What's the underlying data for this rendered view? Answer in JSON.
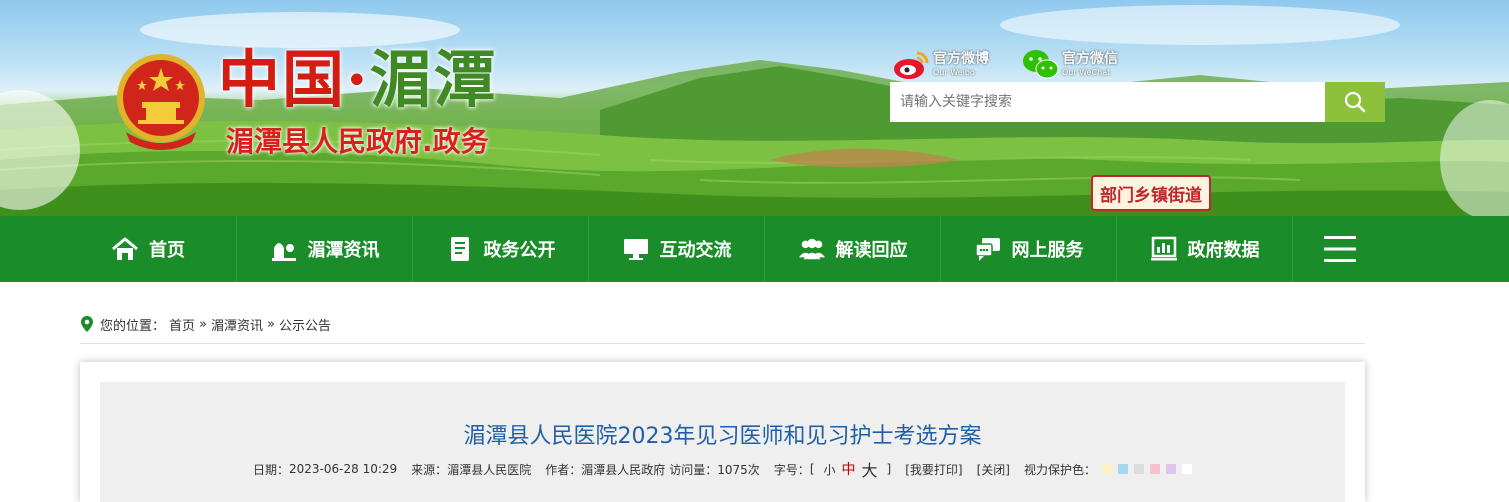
{
  "header": {
    "title_part1": "中国",
    "title_dot": "·",
    "title_part2": "湄潭",
    "subtitle": "湄潭县人民政府.政务",
    "social": [
      {
        "name": "官方微博",
        "en": "Our Weibo"
      },
      {
        "name": "官方微信",
        "en": "Our WeChat"
      }
    ],
    "search": {
      "placeholder": "请输入关键字搜索"
    },
    "dept_button": "部门乡镇街道"
  },
  "nav": {
    "items": [
      {
        "label": "首页",
        "icon": "home-icon"
      },
      {
        "label": "湄潭资讯",
        "icon": "news-icon"
      },
      {
        "label": "政务公开",
        "icon": "document-icon"
      },
      {
        "label": "互动交流",
        "icon": "monitor-icon"
      },
      {
        "label": "解读回应",
        "icon": "people-icon"
      },
      {
        "label": "网上服务",
        "icon": "chat-icon"
      },
      {
        "label": "政府数据",
        "icon": "chart-icon"
      }
    ],
    "menu_icon": "hamburger-menu-icon"
  },
  "breadcrumb": {
    "prefix": "您的位置：",
    "items": [
      "首页",
      "湄潭资讯",
      "公示公告"
    ],
    "separator": "»"
  },
  "article": {
    "title": "湄潭县人民医院2023年见习医师和见习护士考选方案",
    "meta": {
      "date_label": "日期：",
      "date": "2023-06-28 10:29",
      "source_label": "来源：",
      "source": "湄潭县人民医院",
      "author_label": "作者：",
      "author": "湄潭县人民政府",
      "views_label": "访问量：",
      "views": "1075次",
      "fontsize_label": "字号：",
      "bracket_open": "[",
      "size_small": "小",
      "size_medium": "中",
      "size_large": "大",
      "bracket_close": "]",
      "print": "[我要打印]",
      "close": "[关闭]",
      "eye_label": "视力保护色：",
      "eye_colors": [
        "#fbf3c4",
        "#a8d8f0",
        "#dcdcdc",
        "#f6c2d2",
        "#dcc5ef",
        "#ffffff"
      ]
    }
  },
  "colors": {
    "nav_green": "#1a8d2a",
    "search_green": "#8dc13b",
    "title_blue": "#1f5fa7",
    "subtitle_red": "#d8211a"
  }
}
